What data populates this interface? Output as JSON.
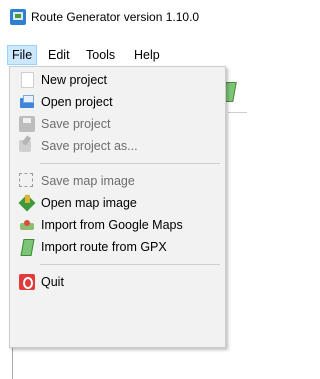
{
  "window": {
    "title": "Route Generator version 1.10.0"
  },
  "menubar": {
    "items": [
      "File",
      "Edit",
      "Tools",
      "Help"
    ]
  },
  "file_menu": {
    "items": [
      {
        "label": "New project",
        "icon": "new-document-icon",
        "enabled": true
      },
      {
        "label": "Open project",
        "icon": "open-folder-icon",
        "enabled": true
      },
      {
        "label": "Save project",
        "icon": "save-icon",
        "enabled": false
      },
      {
        "label": "Save project as...",
        "icon": "save-as-icon",
        "enabled": false
      },
      {
        "label": "Save map image",
        "icon": "save-map-image-icon",
        "enabled": false
      },
      {
        "label": "Open map image",
        "icon": "open-map-image-icon",
        "enabled": true
      },
      {
        "label": "Import from Google Maps",
        "icon": "google-maps-icon",
        "enabled": true
      },
      {
        "label": "Import route from GPX",
        "icon": "gpx-icon",
        "enabled": true
      },
      {
        "label": "Quit",
        "icon": "quit-icon",
        "enabled": true
      }
    ]
  }
}
